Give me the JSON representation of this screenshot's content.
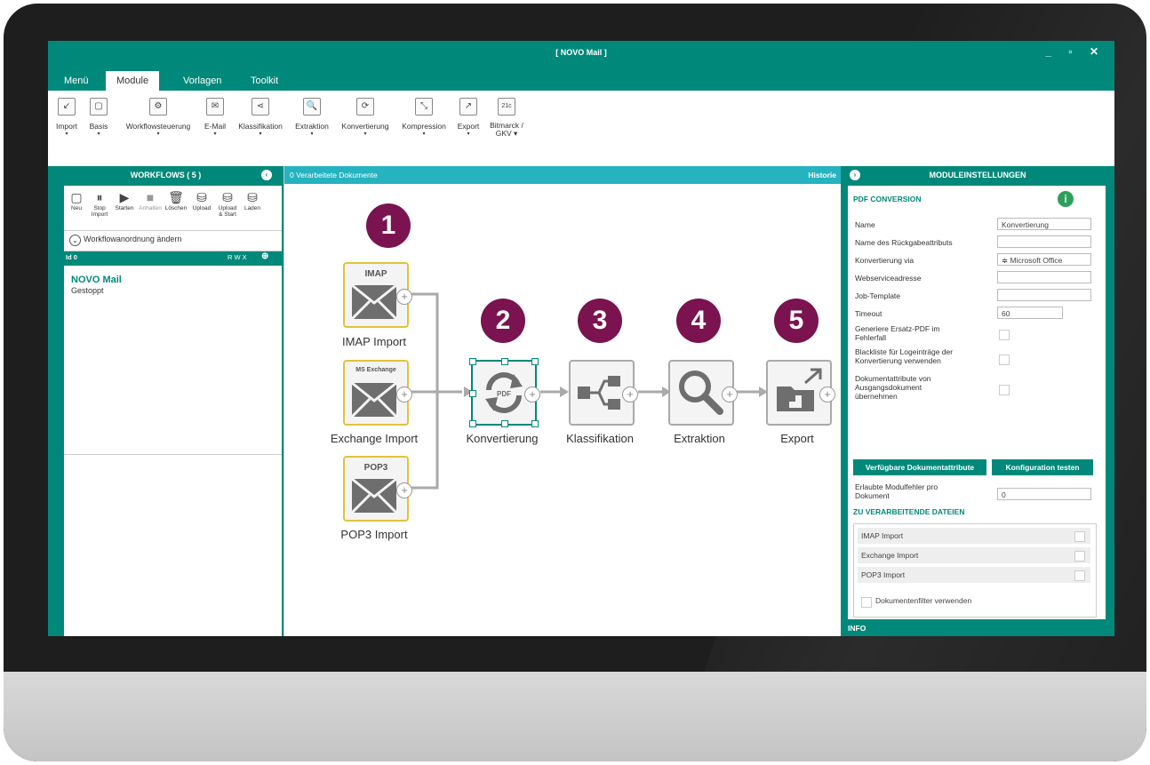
{
  "window": {
    "title": "[ NOVO Mail ]",
    "controls": "_ ▫ ✕"
  },
  "tabs": [
    {
      "label": "Menü"
    },
    {
      "label": "Module"
    },
    {
      "label": "Vorlagen"
    },
    {
      "label": "Toolkit"
    }
  ],
  "ribbon": [
    {
      "label": "Import",
      "icon": "↙"
    },
    {
      "label": "Basis",
      "icon": "▢"
    },
    {
      "label": "Workflowsteuerung",
      "icon": "⚙"
    },
    {
      "label": "E-Mail",
      "icon": "✉"
    },
    {
      "label": "Klassifikation",
      "icon": "⋖"
    },
    {
      "label": "Extraktion",
      "icon": "🔍"
    },
    {
      "label": "Konvertierung",
      "icon": "⟳"
    },
    {
      "label": "Kompression",
      "icon": "⤡"
    },
    {
      "label": "Export",
      "icon": "↗"
    },
    {
      "label": "Bitmarck /",
      "label2": "GKV",
      "icon": "21c"
    }
  ],
  "workflows": {
    "header": "WORKFLOWS  ( 5 )",
    "tools": [
      {
        "label": "Neu",
        "icon": "▢"
      },
      {
        "label": "Stop",
        "label2": "Import",
        "icon": "⏸"
      },
      {
        "label": "Starten",
        "icon": "▶"
      },
      {
        "label": "Anhalten",
        "icon": "■"
      },
      {
        "label": "Löschen",
        "icon": "🗑"
      },
      {
        "label": "Upload",
        "icon": "⛁"
      },
      {
        "label": "Upload",
        "label2": "& Start",
        "icon": "⛁"
      },
      {
        "label": "Laden",
        "icon": "⛁"
      }
    ],
    "reorder_label": "Workflowanordnung ändern",
    "id_label": "Id 0",
    "rwx": "R W X",
    "item_name": "NOVO Mail",
    "item_status": "Gestoppt"
  },
  "center": {
    "processed": "0 Verarbeitete Dokumente",
    "history": "Historie",
    "steps": [
      "1",
      "2",
      "3",
      "4",
      "5"
    ],
    "sources": [
      {
        "label": "IMAP Import",
        "tag": "IMAP"
      },
      {
        "label": "Exchange Import",
        "tag": "MS Exchange"
      },
      {
        "label": "POP3 Import",
        "tag": "POP3"
      }
    ],
    "modules": [
      {
        "label": "Konvertierung"
      },
      {
        "label": "Klassifikation"
      },
      {
        "label": "Extraktion"
      },
      {
        "label": "Export"
      }
    ],
    "pdf_tag": "PDF"
  },
  "settings": {
    "header": "MODULEINSTELLUNGEN",
    "section": "PDF CONVERSION",
    "fields": [
      {
        "label": "Name",
        "value": "Konvertierung"
      },
      {
        "label": "Name des Rückgabeattributs",
        "value": ""
      },
      {
        "label": "Konvertierung via",
        "value": "≑ Microsoft Office"
      },
      {
        "label": "Webserviceadresse",
        "value": ""
      },
      {
        "label": "Job-Template",
        "value": ""
      },
      {
        "label": "Timeout",
        "value": "60"
      }
    ],
    "checks": [
      {
        "label": "Generiere Ersatz-PDF im Fehlerfall"
      },
      {
        "label": "Blackliste für Logeinträge der Konvertierung verwenden"
      },
      {
        "label": "Dokumentattribute von Ausgangsdokument übernehmen"
      }
    ],
    "btn_attributes": "Verfügbare Dokumentattribute",
    "btn_test": "Konfiguration testen",
    "errors_label": "Erlaubte Modulfehler pro Dokument",
    "errors_value": "0",
    "files_section": "ZU VERARBEITENDE DATEIEN",
    "files": [
      "IMAP Import",
      "Exchange Import",
      "POP3 Import"
    ],
    "filter_label": "Dokumentenfilter verwenden",
    "info_section": "INFO"
  },
  "colors": {
    "teal": "#00897b",
    "cyan": "#26b3c0",
    "badge": "#7a1350",
    "source_border": "#e3c23a"
  }
}
